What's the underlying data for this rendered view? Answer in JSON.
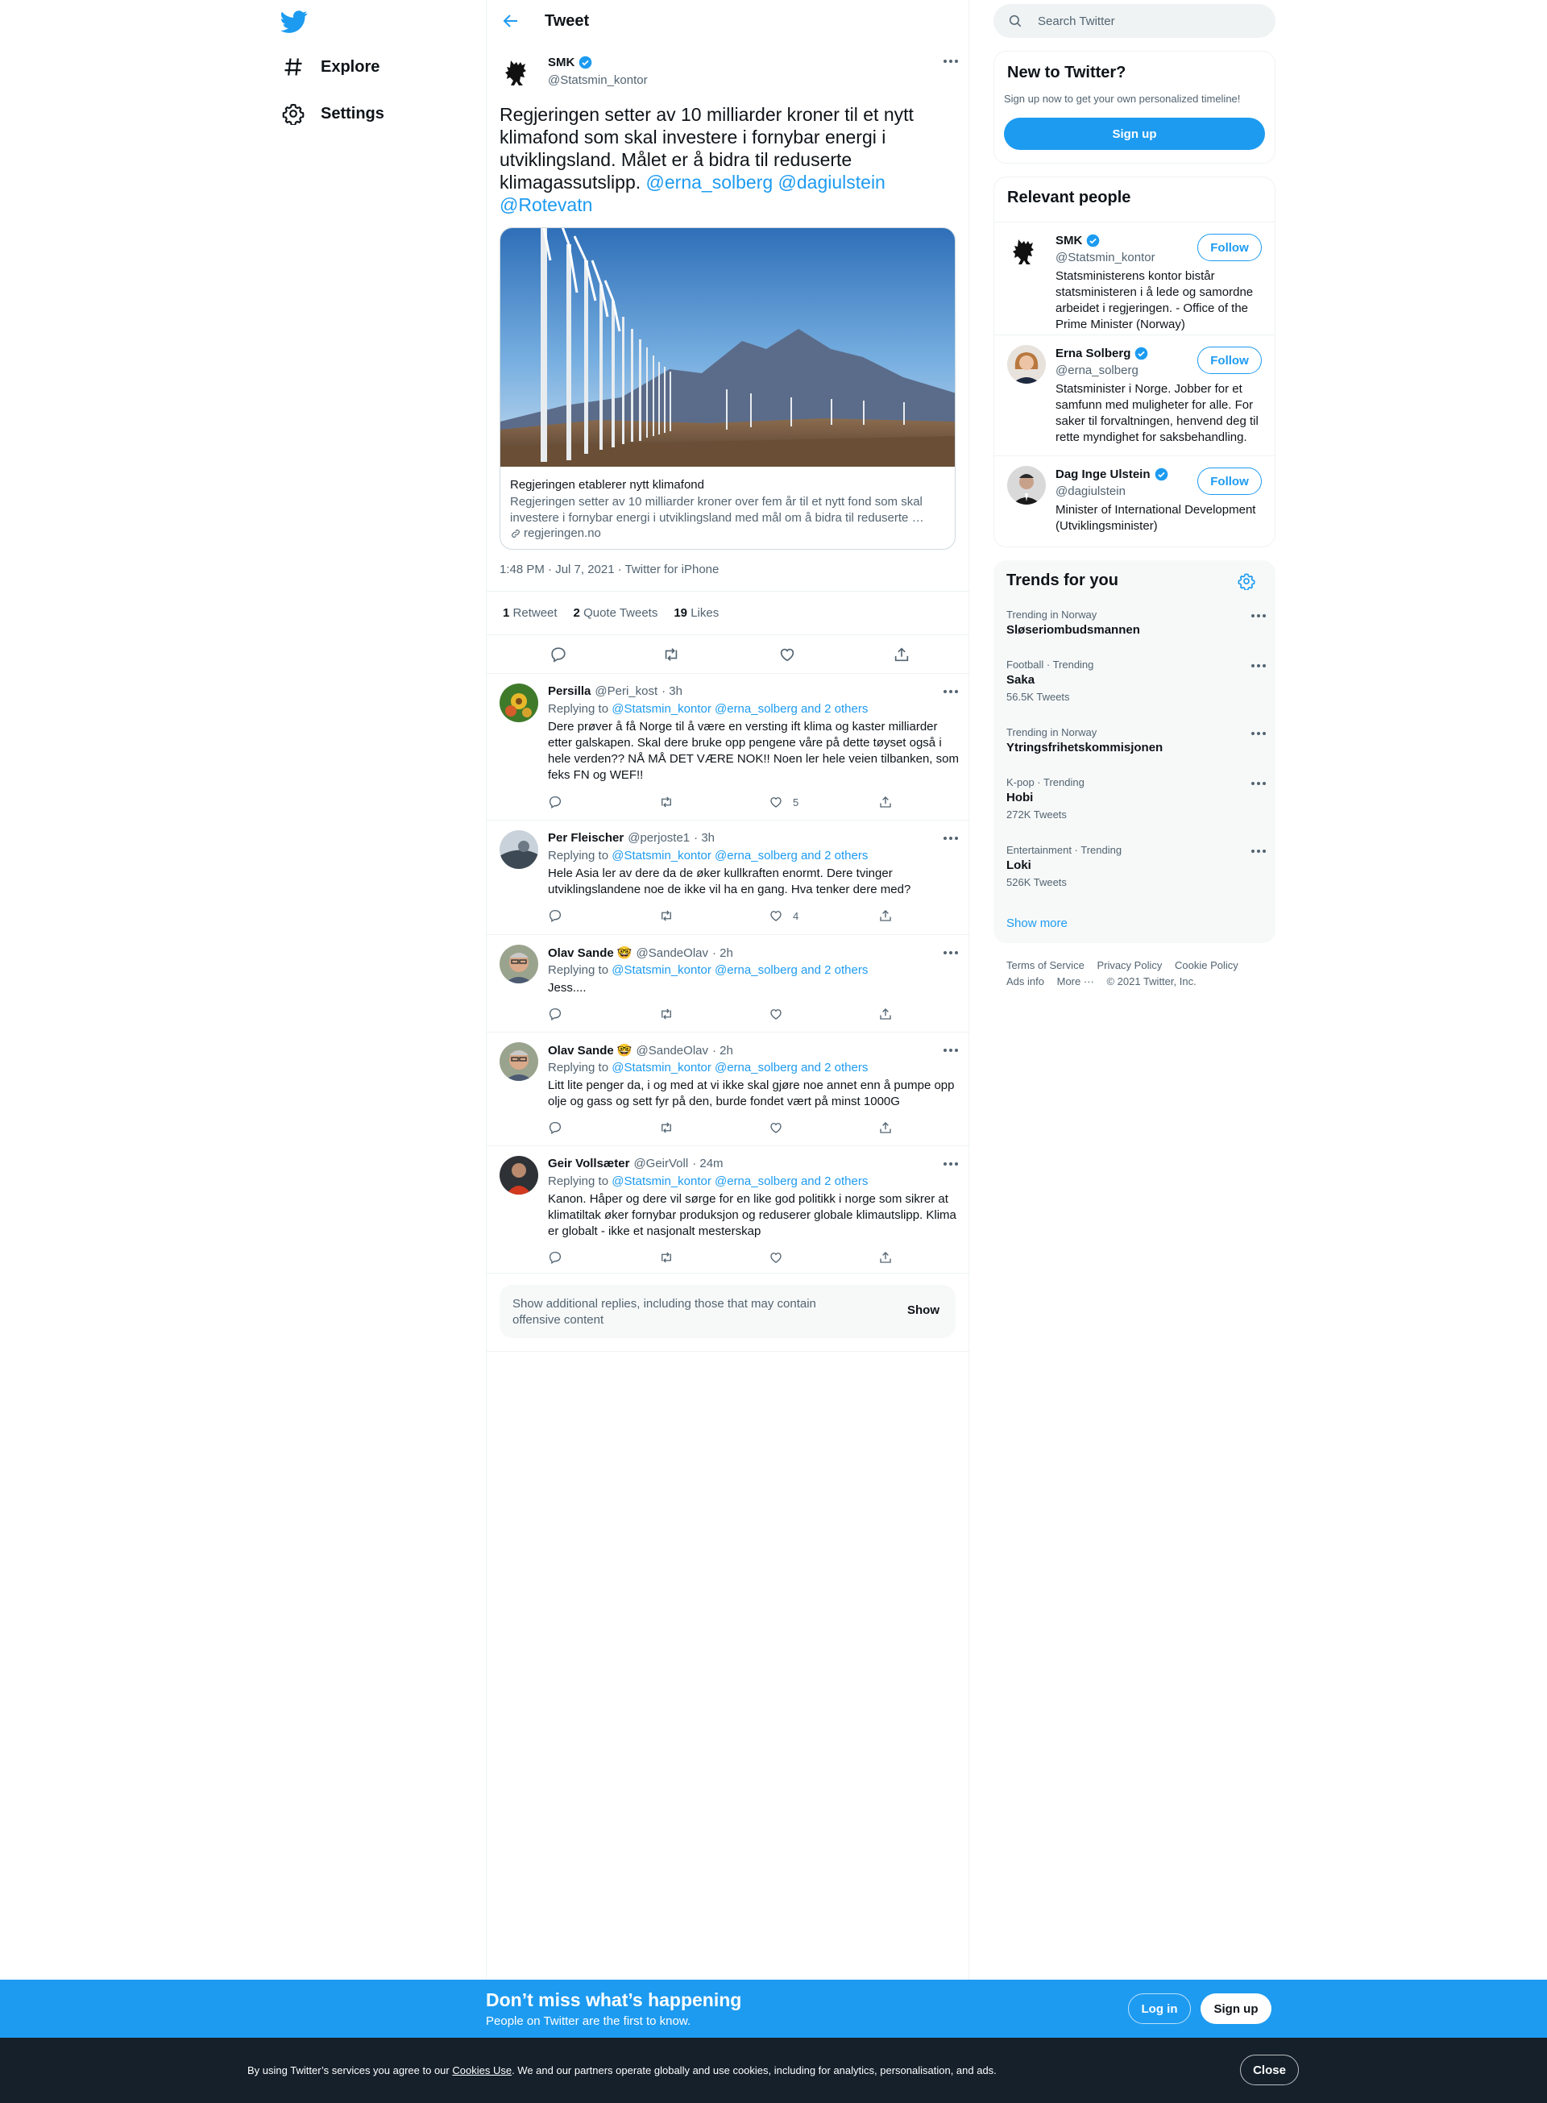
{
  "nav": {
    "items": [
      {
        "label": "Explore",
        "icon": "hashtag-icon"
      },
      {
        "label": "Settings",
        "icon": "gear-icon"
      }
    ]
  },
  "header": {
    "title": "Tweet"
  },
  "tweet": {
    "author_name": "SMK",
    "author_handle": "@Statsmin_kontor",
    "text": "Regjeringen setter av 10 milliarder kroner til et nytt klimafond som skal investere i fornybar energi i utviklingsland. Målet er å bidra til reduserte klimagassutslipp.",
    "mentions": [
      "@erna_solberg",
      "@dagiulstein",
      "@Rotevatn"
    ],
    "card": {
      "title": "Regjeringen etablerer nytt klimafond",
      "description": "Regjeringen setter av 10 milliarder kroner over fem år til et nytt fond som skal investere i fornybar energi i utviklingsland med mål om å bidra til reduserte …",
      "domain": "regjeringen.no"
    },
    "timestamp": "1:48 PM · Jul 7, 2021 · Twitter for iPhone",
    "stats": {
      "retweets": "1",
      "retweets_label": "Retweet",
      "quotes": "2",
      "quotes_label": "Quote Tweets",
      "likes": "19",
      "likes_label": "Likes"
    }
  },
  "replies": [
    {
      "name": "Persilla",
      "handle": "@Peri_kost",
      "time": "· 3h",
      "replying_prefix": "Replying to",
      "replying_to": "@Statsmin_kontor @erna_solberg and 2 others",
      "text": "Dere prøver å få Norge til å være en versting ift klima og kaster milliarder etter galskapen. Skal dere bruke opp pengene våre på dette tøyset også i hele verden?? NÅ MÅ DET VÆRE NOK!! Noen ler hele veien tilbanken, som feks FN og WEF!!",
      "likes": "5"
    },
    {
      "name": "Per Fleischer",
      "handle": "@perjoste1",
      "time": "· 3h",
      "replying_prefix": "Replying to",
      "replying_to": "@Statsmin_kontor @erna_solberg and 2 others",
      "text": "Hele Asia ler av dere da de øker kullkraften enormt. Dere tvinger utviklingslandene noe de ikke vil ha en gang. Hva tenker dere med?",
      "likes": "4"
    },
    {
      "name": "Olav Sande 🤓",
      "handle": "@SandeOlav",
      "time": "· 2h",
      "replying_prefix": "Replying to",
      "replying_to": "@Statsmin_kontor @erna_solberg and 2 others",
      "text": "Jess....",
      "likes": ""
    },
    {
      "name": "Olav Sande 🤓",
      "handle": "@SandeOlav",
      "time": "· 2h",
      "replying_prefix": "Replying to",
      "replying_to": "@Statsmin_kontor @erna_solberg and 2 others",
      "text": "Litt lite penger da, i og med at vi ikke skal gjøre noe annet enn å pumpe opp olje og gass og sett fyr på den, burde fondet vært på minst 1000G",
      "likes": ""
    },
    {
      "name": "Geir Vollsæter",
      "handle": "@GeirVoll",
      "time": "· 24m",
      "replying_prefix": "Replying to",
      "replying_to": "@Statsmin_kontor @erna_solberg and 2 others",
      "text": "Kanon. Håper og dere vil sørge for en like god politikk i norge som sikrer at klimatiltak øker fornybar produksjon og reduserer globale  klimautslipp. Klima er globalt - ikke et nasjonalt mesterskap",
      "likes": ""
    }
  ],
  "show_more": {
    "text": "Show additional replies, including those that may contain offensive content",
    "button": "Show"
  },
  "search": {
    "placeholder": "Search Twitter"
  },
  "new_to_twitter": {
    "title": "New to Twitter?",
    "subtitle": "Sign up now to get your own personalized timeline!",
    "button": "Sign up"
  },
  "relevant_people": {
    "title": "Relevant people",
    "follow_label": "Follow",
    "people": [
      {
        "name": "SMK",
        "handle": "@Statsmin_kontor",
        "bio": "Statsministerens kontor bistår statsministeren i å lede og samordne arbeidet i regjeringen. - Office of the Prime Minister (Norway)"
      },
      {
        "name": "Erna Solberg",
        "handle": "@erna_solberg",
        "bio": "Statsminister i Norge. Jobber for et samfunn med muligheter for alle. For saker til forvaltningen, henvend deg til rette myndighet for saksbehandling."
      },
      {
        "name": "Dag Inge Ulstein",
        "handle": "@dagiulstein",
        "bio": "Minister of International Development (Utviklingsminister)"
      }
    ]
  },
  "trends": {
    "title": "Trends for you",
    "items": [
      {
        "context": "Trending in Norway",
        "name": "Sløseriombudsmannen",
        "count": ""
      },
      {
        "context": "Football · Trending",
        "name": "Saka",
        "count": "56.5K Tweets"
      },
      {
        "context": "Trending in Norway",
        "name": "Ytringsfrihetskommisjonen",
        "count": ""
      },
      {
        "context": "K-pop · Trending",
        "name": "Hobi",
        "count": "272K Tweets"
      },
      {
        "context": "Entertainment · Trending",
        "name": "Loki",
        "count": "526K Tweets"
      }
    ],
    "show_more": "Show more"
  },
  "footer": {
    "links": [
      "Terms of Service",
      "Privacy Policy",
      "Cookie Policy",
      "Ads info",
      "More ···"
    ],
    "copyright": "© 2021 Twitter, Inc."
  },
  "bottom_bar": {
    "title": "Don’t miss what’s happening",
    "subtitle": "People on Twitter are the first to know.",
    "login": "Log in",
    "signup": "Sign up"
  },
  "cookie": {
    "text_before": "By using Twitter’s services you agree to our ",
    "link": "Cookies Use",
    "text_after": ". We and our partners operate globally and use cookies, including for analytics, personalisation, and ads.",
    "close": "Close"
  },
  "colors": {
    "accent": "#1d9bf0",
    "text": "#0f1419",
    "secondary": "#536471",
    "cookie_bg": "#15202b"
  }
}
